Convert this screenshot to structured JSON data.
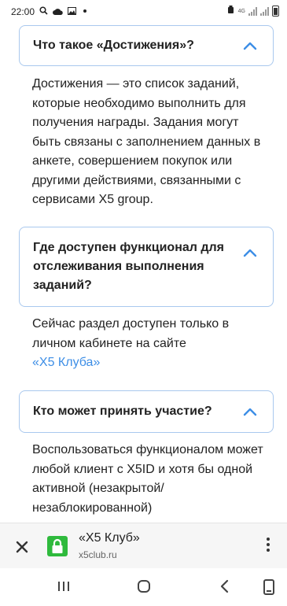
{
  "status_bar": {
    "time": "22:00",
    "network_label": "4G"
  },
  "faq": [
    {
      "question": "Что такое «Достижения»?",
      "answer": "Достижения — это список заданий, которые необходимо выполнить для получения награды. Задания могут быть связаны с заполнением данных в анкете, совершением покупок или другими действиями, связанными с сервисами X5 group."
    },
    {
      "question": "Где доступен функционал для отслеживания выполнения заданий?",
      "answer": "Сейчас раздел доступен только в личном кабинете на сайте",
      "answer_link": "«X5 Клуба»"
    },
    {
      "question": "Кто может принять участие?",
      "answer": "Воспользоваться функционалом может любой клиент с X5ID и хотя бы одной активной (незакрытой/незаблокированной)"
    }
  ],
  "browser_bar": {
    "site_title": "«X5 Клуб»",
    "site_url": "x5club.ru"
  },
  "colors": {
    "card_border": "#a9c8ee",
    "accent": "#3d8ee6",
    "lock_green": "#2fba3d"
  }
}
